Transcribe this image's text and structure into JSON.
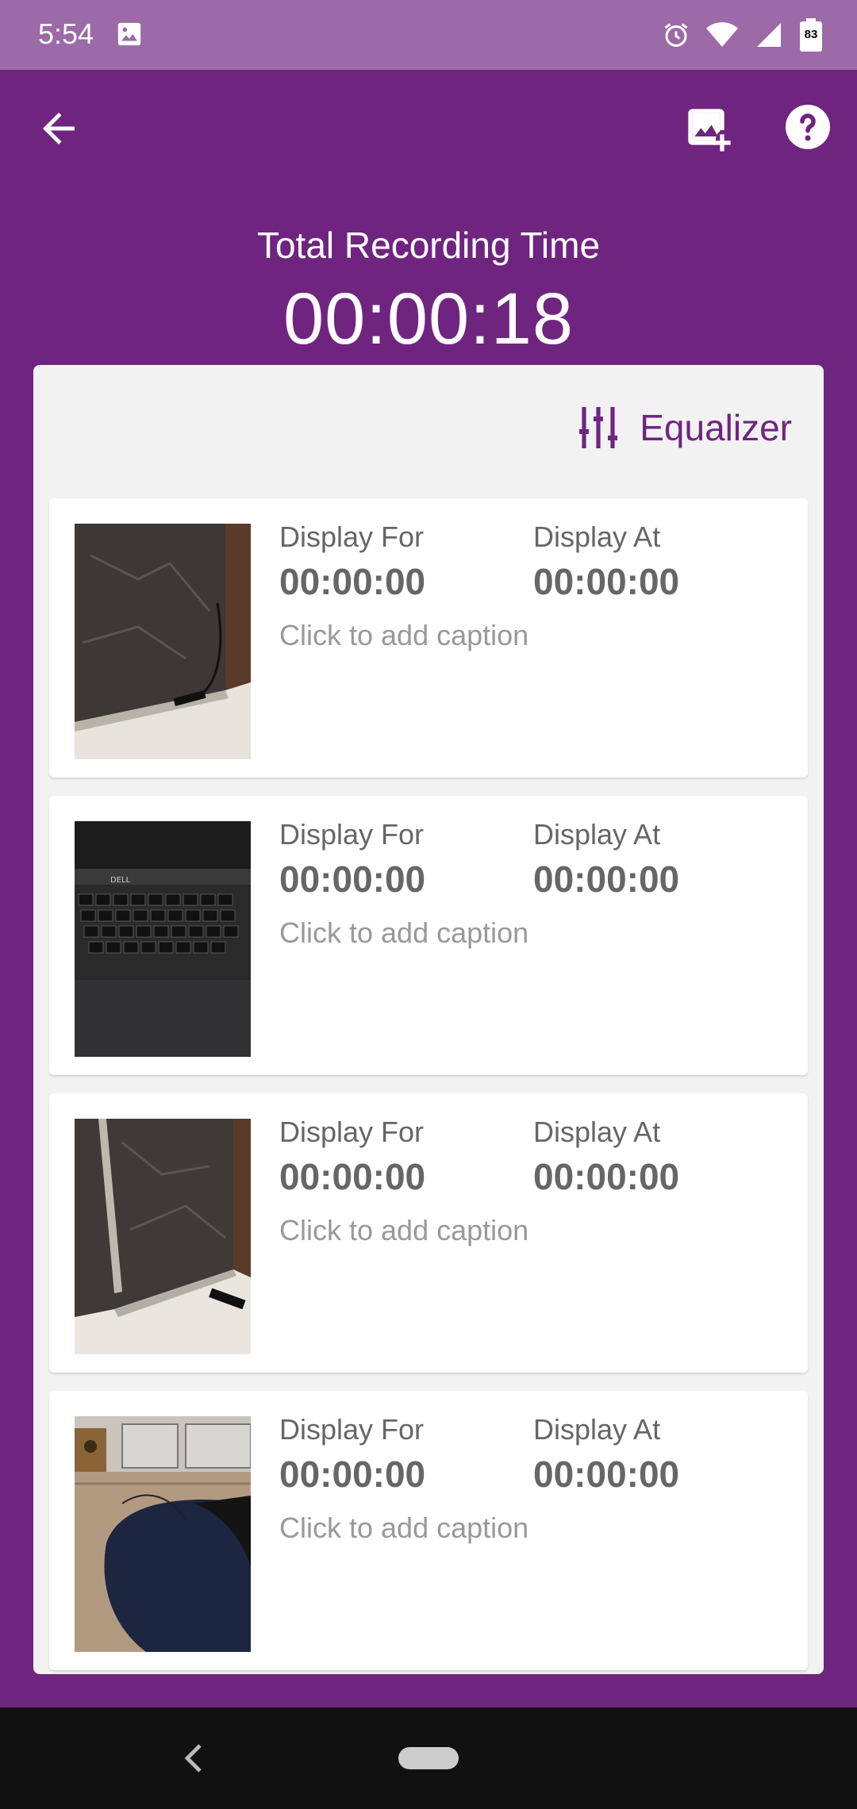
{
  "status_bar": {
    "time": "5:54",
    "battery": "83",
    "icons": [
      "image-icon",
      "alarm-icon",
      "wifi-icon",
      "signal-icon",
      "battery-icon"
    ]
  },
  "app_bar": {
    "icons": [
      "back-arrow-icon",
      "add-image-icon",
      "help-icon"
    ]
  },
  "header": {
    "label": "Total Recording Time",
    "time": "00:00:18"
  },
  "equalizer": {
    "label": "Equalizer",
    "icon": "equalizer-icon"
  },
  "slides": [
    {
      "display_for_label": "Display For",
      "display_for": "00:00:00",
      "display_at_label": "Display At",
      "display_at": "00:00:00",
      "caption": "Click to add caption"
    },
    {
      "display_for_label": "Display For",
      "display_for": "00:00:00",
      "display_at_label": "Display At",
      "display_at": "00:00:00",
      "caption": "Click to add caption"
    },
    {
      "display_for_label": "Display For",
      "display_for": "00:00:00",
      "display_at_label": "Display At",
      "display_at": "00:00:00",
      "caption": "Click to add caption"
    },
    {
      "display_for_label": "Display For",
      "display_for": "00:00:00",
      "display_at_label": "Display At",
      "display_at": "00:00:00",
      "caption": "Click to add caption"
    }
  ],
  "colors": {
    "primary": "#6f2580",
    "status_bar": "#9b6aa7",
    "panel": "#f2f2f2"
  }
}
